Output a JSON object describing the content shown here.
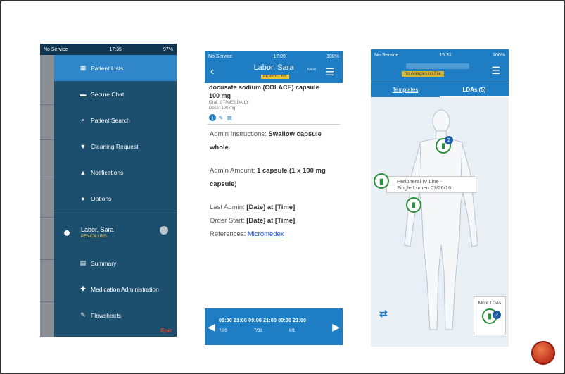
{
  "phone1": {
    "status": {
      "left": "No Service",
      "time": "17:35",
      "right": "97%"
    },
    "menu": [
      {
        "label": "Patient Lists",
        "icon": "patient-lists-icon",
        "glyph": "▦",
        "active": true
      },
      {
        "label": "Secure Chat",
        "icon": "chat-icon",
        "glyph": "▬"
      },
      {
        "label": "Patient Search",
        "icon": "search-icon",
        "glyph": "⌕"
      },
      {
        "label": "Cleaning Request",
        "icon": "cleaning-icon",
        "glyph": "▼"
      },
      {
        "label": "Notifications",
        "icon": "bell-icon",
        "glyph": "▲"
      },
      {
        "label": "Options",
        "icon": "options-icon",
        "glyph": "●"
      }
    ],
    "patient": {
      "name": "Labor, Sara",
      "allergy": "PENICILLINS"
    },
    "submenu": [
      {
        "label": "Summary",
        "icon": "summary-icon",
        "glyph": "▤"
      },
      {
        "label": "Medication Administration",
        "icon": "medication-icon",
        "glyph": "✚"
      },
      {
        "label": "Flowsheets",
        "icon": "flowsheets-icon",
        "glyph": "✎"
      }
    ],
    "brand": "Epic"
  },
  "phone2": {
    "status": {
      "left": "No Service",
      "time": "17:09",
      "right": "100%"
    },
    "patient_name": "Labor, Sara",
    "allergy": "PENICILLINS",
    "more": "Next",
    "drug": "docusate sodium (COLACE) capsule",
    "dose_bold": "100 mg",
    "freq": "Oral, 2 TIMES DAILY",
    "dose_small": "Dose: 100 mg",
    "admin_instr_label": "Admin Instructions:",
    "admin_instr_value": "Swallow capsule whole.",
    "admin_amount_label": "Admin Amount:",
    "admin_amount_value": "1 capsule (1 x 100 mg capsule)",
    "last_admin_label": "Last Admin:",
    "last_admin_value": "[Date] at [Time]",
    "order_start_label": "Order Start:",
    "order_start_value": "[Date] at [Time]",
    "references_label": "References:",
    "references_link": "Micromedex",
    "timeline_times": "09:00  21:00  09:00  21:00  09:00  21:00",
    "timeline_dates": [
      "7/30",
      "7/31",
      "8/1"
    ]
  },
  "phone3": {
    "status": {
      "left": "No Service",
      "time": "15:31",
      "right": "100%"
    },
    "allergy": "No Allergies on File",
    "tabs": {
      "templates": "Templates",
      "ldas": "LDAs (5)"
    },
    "lda_label_line1": "Peripheral IV Line -",
    "lda_label_line2": "Single Lumen 07/26/16...",
    "badge_top": "2",
    "badge_more": "2",
    "more_ldas": "More LDAs"
  }
}
